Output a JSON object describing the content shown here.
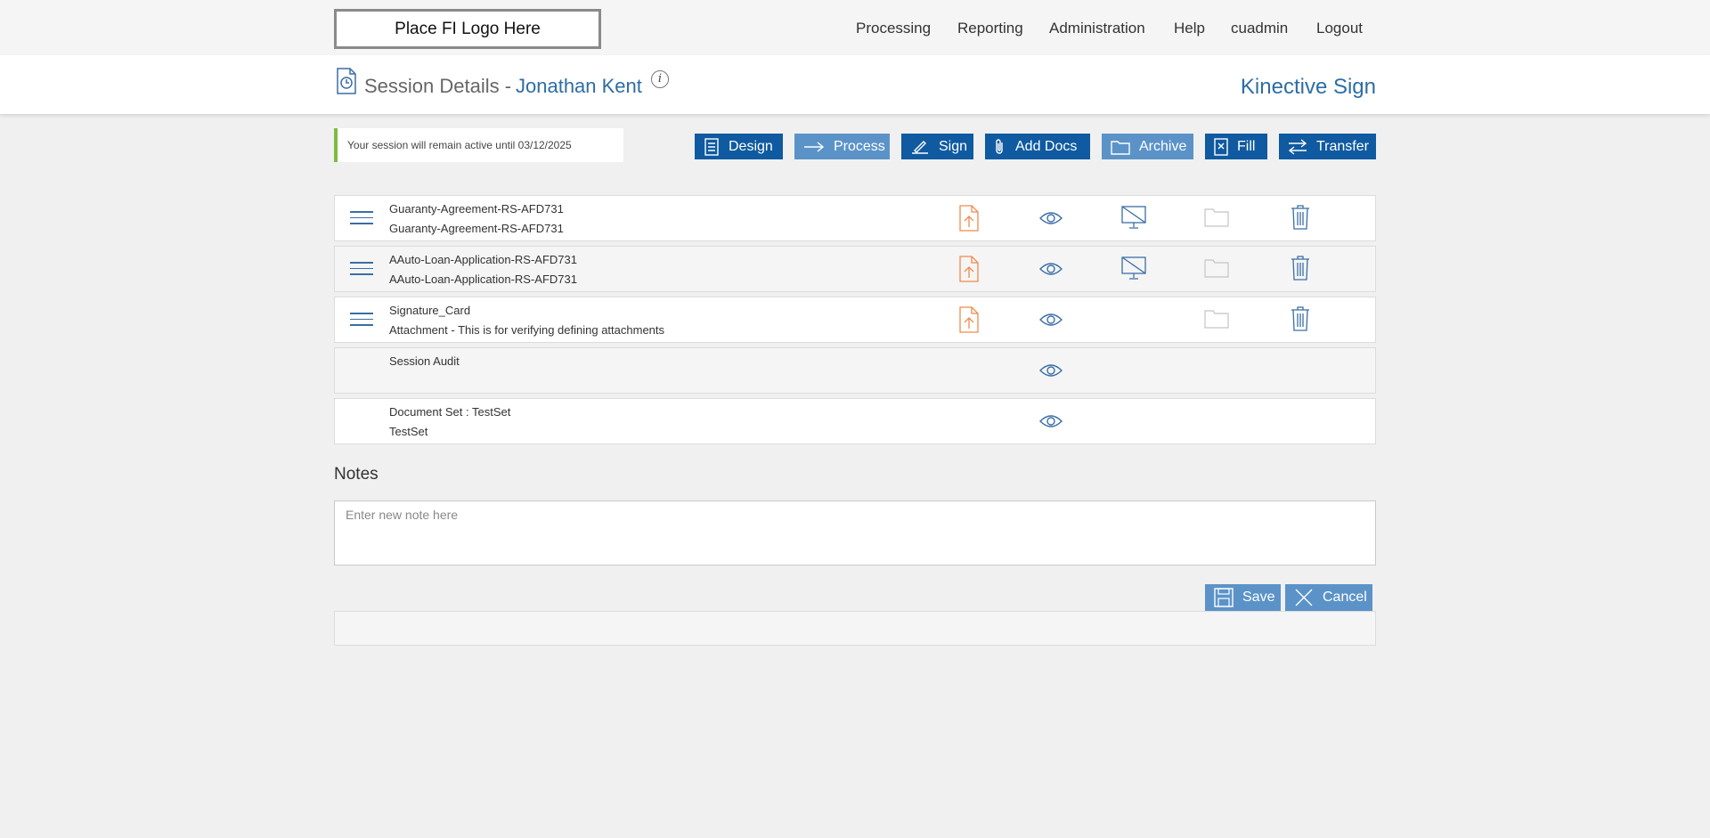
{
  "logo": {
    "text": "Place FI Logo Here"
  },
  "nav": {
    "items": [
      "Processing",
      "Reporting",
      "Administration",
      "Help",
      "cuadmin",
      "Logout"
    ]
  },
  "header": {
    "title": "Session Details -",
    "customer": "Jonathan Kent",
    "brand": "Kinective Sign"
  },
  "notice": {
    "text": "Your session will remain active until 03/12/2025",
    "accent_color": "#7dbb42"
  },
  "actions": [
    {
      "label": "Design",
      "icon": "document-list-icon",
      "style": "dark"
    },
    {
      "label": "Process",
      "icon": "arrow-right-icon",
      "style": "light"
    },
    {
      "label": "Sign",
      "icon": "pen-icon",
      "style": "dark"
    },
    {
      "label": "Add Docs",
      "icon": "paperclip-icon",
      "style": "dark"
    },
    {
      "label": "Archive",
      "icon": "folder-icon",
      "style": "light"
    },
    {
      "label": "Fill",
      "icon": "form-fill-icon",
      "style": "dark"
    },
    {
      "label": "Transfer",
      "icon": "swap-arrows-icon",
      "style": "dark"
    }
  ],
  "documents": [
    {
      "name": "Guaranty-Agreement-RS-AFD731",
      "description": "Guaranty-Agreement-RS-AFD731",
      "icons": [
        "upload-file-icon",
        "eye-icon",
        "monitor-disabled-icon",
        "folder-icon",
        "trash-icon"
      ]
    },
    {
      "name": "AAuto-Loan-Application-RS-AFD731",
      "description": "AAuto-Loan-Application-RS-AFD731",
      "icons": [
        "upload-file-icon",
        "eye-icon",
        "monitor-disabled-icon",
        "folder-icon",
        "trash-icon"
      ]
    },
    {
      "name": "Signature_Card",
      "description": "Attachment - This is for verifying defining attachments",
      "icons": [
        "upload-file-icon",
        "eye-icon",
        "folder-icon",
        "trash-icon"
      ]
    },
    {
      "name": "Session Audit",
      "description": "",
      "icons": [
        "eye-icon"
      ]
    },
    {
      "name": "Document Set : TestSet",
      "description": "TestSet",
      "icons": [
        "eye-icon"
      ]
    }
  ],
  "notes": {
    "title": "Notes",
    "placeholder": "Enter new note here",
    "save_label": "Save",
    "cancel_label": "Cancel"
  },
  "colors": {
    "primary": "#0f5aa0",
    "secondary": "#5b93c8",
    "link": "#2e6da4",
    "upload": "#f08a4b"
  }
}
